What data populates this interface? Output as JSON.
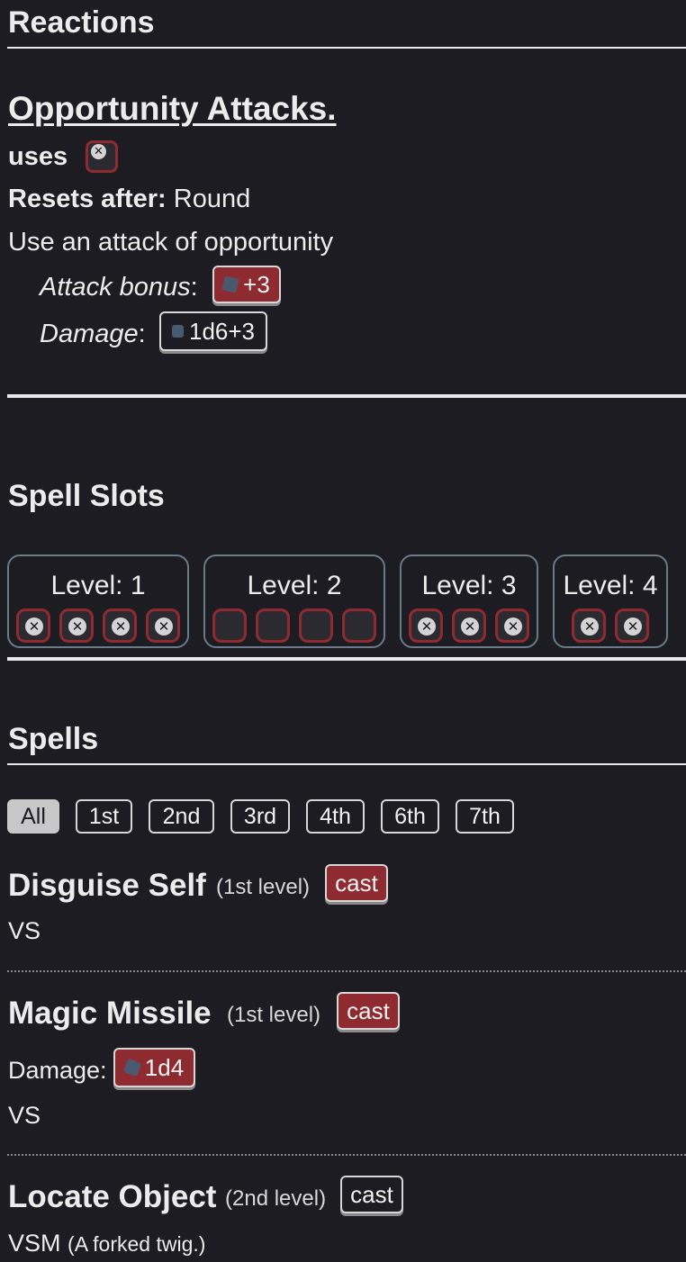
{
  "reactions": {
    "heading": "Reactions",
    "name": "Opportunity Attacks.",
    "uses_label": "uses",
    "resets_label": "Resets after:",
    "resets_value": "Round",
    "description": "Use an attack of opportunity",
    "attack_label": "Attack bonus",
    "attack_colon": ":",
    "attack_value": "+3",
    "damage_label": "Damage",
    "damage_colon": ":",
    "damage_value": "1d6+3"
  },
  "spell_slots": {
    "heading": "Spell Slots",
    "levels": [
      {
        "label": "Level: 1",
        "used": 4,
        "total": 4
      },
      {
        "label": "Level: 2",
        "used": 0,
        "total": 4
      },
      {
        "label": "Level: 3",
        "used": 3,
        "total": 3
      },
      {
        "label": "Level: 4",
        "used": 2,
        "total": 2
      }
    ]
  },
  "spells": {
    "heading": "Spells",
    "filters": [
      "All",
      "1st",
      "2nd",
      "3rd",
      "4th",
      "6th",
      "7th"
    ],
    "active_filter": "All",
    "list": [
      {
        "name": "Disguise Self",
        "level": "(1st level)",
        "cast": "cast",
        "components": "VS"
      },
      {
        "name": "Magic Missile",
        "level": "(1st level)",
        "cast": "cast",
        "damage_label": "Damage:",
        "damage_value": "1d4",
        "components": "VS"
      },
      {
        "name": "Locate Object",
        "level": "(2nd level)",
        "cast": "cast",
        "components": "VSM",
        "material": "(A forked twig.)"
      }
    ]
  },
  "colors": {
    "background": "#1c1c22",
    "accent_red": "#8e2b30",
    "text": "#ececec"
  }
}
